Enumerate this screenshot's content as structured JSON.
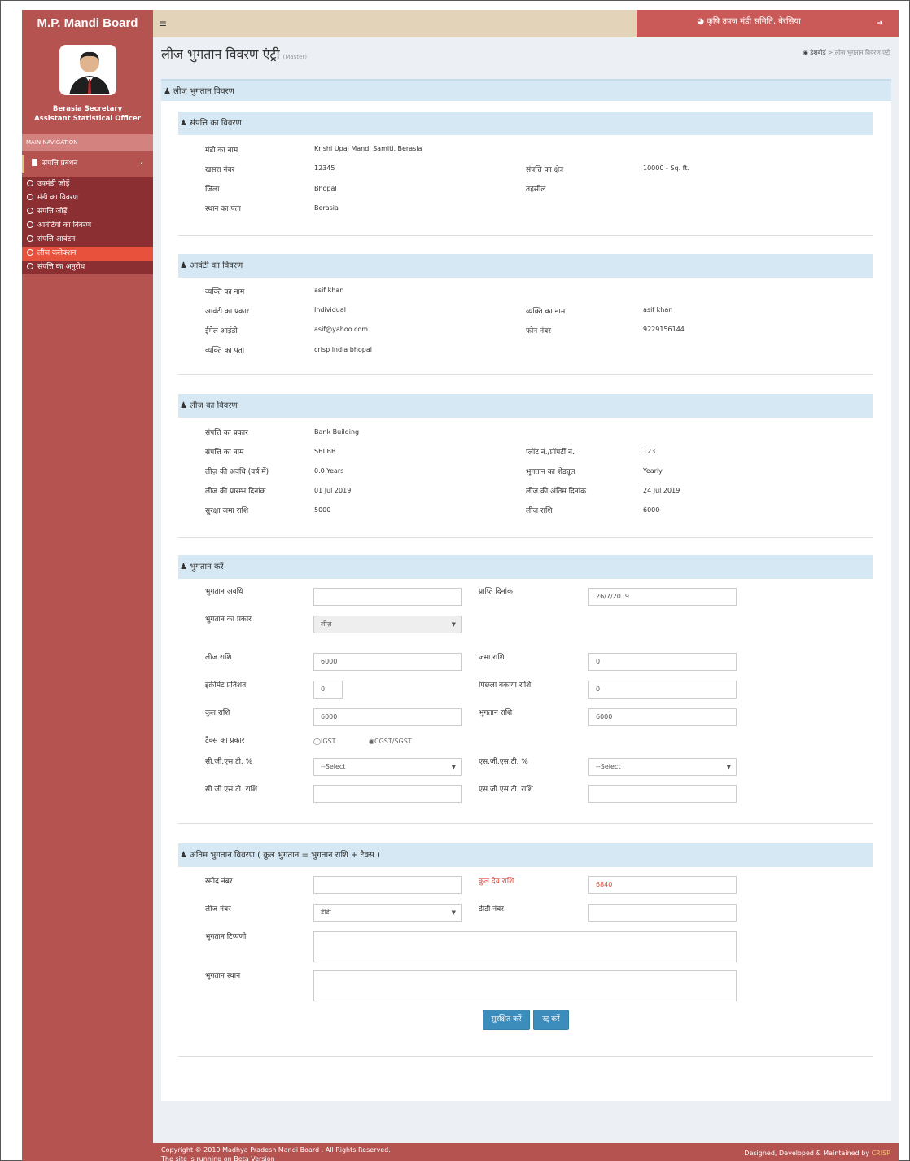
{
  "brand": "M.P. Mandi Board",
  "header": {
    "menu_icon": "≡",
    "mandi_name": "◕ कृषि उपज मंडी समिति, बेरसिया",
    "logout_icon": "➜"
  },
  "user": {
    "name": "Berasia Secretary",
    "role": "Assistant Statistical Officer"
  },
  "nav": {
    "heading": "MAIN NAVIGATION",
    "parent": "संपत्ति प्रबंधन",
    "items": [
      "उपमंडी जोड़ें",
      "मंडी का विवरण",
      "संपत्ति जोड़ें",
      "आवंटियों का विवरण",
      "संपत्ति आवंटन",
      "लीज कलेक्शन",
      "संपत्ति का अनुरोध"
    ]
  },
  "page": {
    "title": "लीज भुगतान विवरण एंट्री",
    "subtitle": "(Master)"
  },
  "breadcrumb": {
    "home": "डैशबोर्ड",
    "current": "लीज भुगतान विवरण एंट्री"
  },
  "main_box_title": "लीज भुगतान विवरण",
  "property": {
    "title": "संपत्ति का विवरण",
    "mandi_label": "मंडी का नाम",
    "mandi_value": "Krishi Upaj Mandi Samiti, Berasia",
    "khasra_label": "खसरा नंबर",
    "khasra_value": "12345",
    "area_label": "संपत्ति का क्षेत्र",
    "area_value": "10000 - Sq. ft.",
    "district_label": "जिला",
    "district_value": "Bhopal",
    "tehsil_label": "तहसील",
    "address_label": "स्थान का पता",
    "address_value": "Berasia"
  },
  "allottee": {
    "title": "आवंटी का विवरण",
    "person_label": "व्यक्ति का नाम",
    "person_value": "asif khan",
    "type_label": "आवंटी का प्रकार",
    "type_value": "Individual",
    "person2_label": "व्यक्ति का नाम",
    "person2_value": "asif khan",
    "email_label": "ईमेल आईडी",
    "email_value": "asif@yahoo.com",
    "phone_label": "फ़ोन नंबर",
    "phone_value": "9229156144",
    "address_label": "व्यक्ति का पता",
    "address_value": "crisp india bhopal"
  },
  "lease": {
    "title": "लीज का विवरण",
    "ptype_label": "संपत्ति का प्रकार",
    "ptype_value": "Bank Building",
    "pname_label": "संपत्ति का नाम",
    "pname_value": "SBI BB",
    "plot_label": "प्लॉट नं./प्रॉपर्टी नं.",
    "plot_value": "123",
    "duration_label": "लीज़ की अवधि (वर्ष में)",
    "duration_value": "0.0 Years",
    "schedule_label": "भुगतान का शेड्यूल",
    "schedule_value": "Yearly",
    "start_label": "लीज की प्रारम्भ दिनांक",
    "start_value": "01 Jul 2019",
    "end_label": "लीज की अंतिम दिनांक",
    "end_value": "24 Jul 2019",
    "deposit_label": "सुरक्षा जमा राशि",
    "deposit_value": "5000",
    "amount_label": "लीज राशि",
    "amount_value": "6000"
  },
  "payment": {
    "title": "भुगतान करें",
    "period_label": "भुगतान अवधि",
    "period_value": "",
    "receipt_date_label": "प्राप्ति दिनांक",
    "receipt_date_value": "26/7/2019",
    "ptype_label": "भुगतान का प्रकार",
    "ptype_value": "लीज़",
    "lease_amt_label": "लीज राशि",
    "lease_amt_value": "6000",
    "deposit_label": "जमा राशि",
    "deposit_value": "0",
    "increment_label": "इंक्रीमेंट प्रतिशत",
    "increment_value": "0",
    "prev_due_label": "पिछला बकाया राशि",
    "prev_due_value": "0",
    "total_label": "कुल राशि",
    "total_value": "6000",
    "pay_amt_label": "भुगतान राशि",
    "pay_amt_value": "6000",
    "tax_type_label": "टैक्स का प्रकार",
    "igst_label": "IGST",
    "cgst_label": "CGST/SGST",
    "tax_selected": "CGST/SGST",
    "cgst_pct_label": "सी.जी.एस.टी. %",
    "cgst_pct_value": "--Select",
    "sgst_pct_label": "एस.जी.एस.टी. %",
    "sgst_pct_value": "--Select",
    "cgst_amt_label": "सी.जी.एस.टी. राशि",
    "cgst_amt_value": "",
    "sgst_amt_label": "एस.जी.एस.टी. राशि",
    "sgst_amt_value": ""
  },
  "final": {
    "title": "अंतिम भुगतान विवरण ( कुल भुगतान = भुगतान राशि + टैक्स )",
    "receipt_label": "रसीद नंबर",
    "receipt_value": "",
    "total_due_label": "कुल देय राशि",
    "total_due_value": "6840",
    "lease_no_label": "लीज नंबर",
    "lease_no_value": "डीडी",
    "dd_label": "डीडी नंबर.",
    "dd_value": "",
    "remark_label": "भुगतान टिप्पणी",
    "place_label": "भुगतान स्थान",
    "save_label": "सुरक्षित करें",
    "cancel_label": "रद्द करें"
  },
  "footer": {
    "copyright": "Copyright © 2019 Madhya Pradesh Mandi Board . All Rights Reserved.",
    "beta": "The site is running on Beta Version",
    "credit_prefix": "Designed, Developed & Maintained by",
    "credit_brand": "CRISP"
  },
  "colors": {
    "brand": "#b55351",
    "topbar": "#e3d3b9",
    "active_menu": "#e8523c",
    "section_header": "#d5e8f3",
    "primary_button": "#3c8dbc",
    "highlight_red": "#dd4b39"
  }
}
